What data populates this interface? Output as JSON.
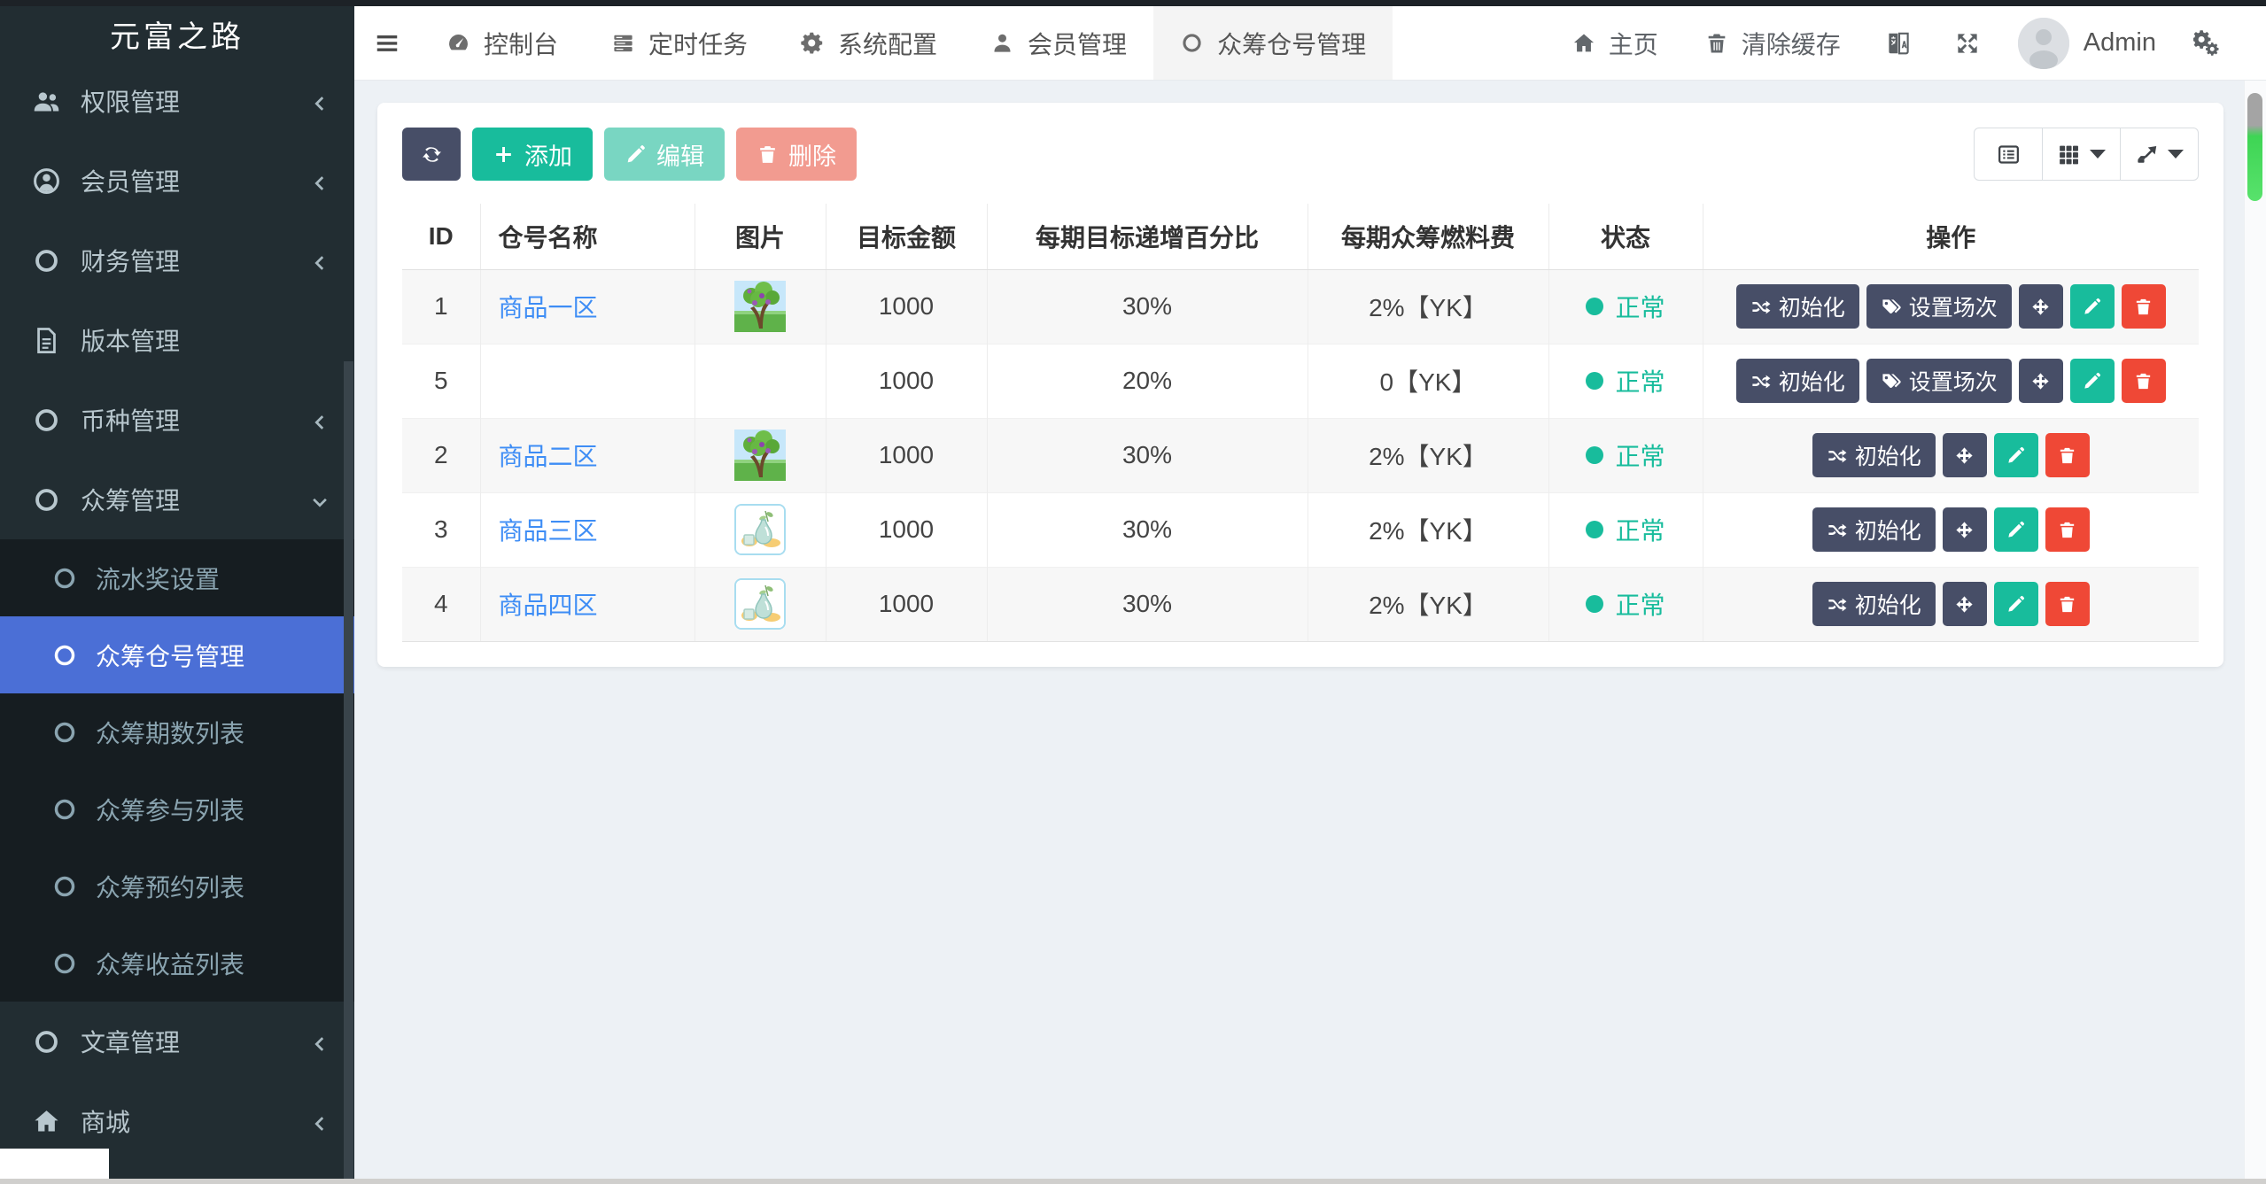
{
  "app_title": "元富之路",
  "colors": {
    "sidebar_bg": "#222d32",
    "submenu_bg": "#161d21",
    "active_menu": "#4b6fd6",
    "primary_green": "#18bc9c",
    "danger_red": "#ef4836",
    "dark_button": "#474e67",
    "link_blue": "#3e8df5",
    "status_green": "#18bc9c",
    "scrollbar_green": "#3ed554"
  },
  "sidebar": {
    "items": [
      {
        "icon": "users",
        "label": "权限管理",
        "chevron": "left"
      },
      {
        "icon": "user-circle",
        "label": "会员管理",
        "chevron": "left"
      },
      {
        "icon": "circle-o",
        "label": "财务管理",
        "chevron": "left"
      },
      {
        "icon": "file-text",
        "label": "版本管理"
      },
      {
        "icon": "circle-o",
        "label": "币种管理",
        "chevron": "left"
      },
      {
        "icon": "circle-o",
        "label": "众筹管理",
        "chevron": "down",
        "open": true,
        "children": [
          {
            "label": "流水奖设置"
          },
          {
            "label": "众筹仓号管理",
            "active": true
          },
          {
            "label": "众筹期数列表"
          },
          {
            "label": "众筹参与列表"
          },
          {
            "label": "众筹预约列表"
          },
          {
            "label": "众筹收益列表"
          }
        ]
      },
      {
        "icon": "circle-o",
        "label": "文章管理",
        "chevron": "left"
      },
      {
        "icon": "home",
        "label": "商城",
        "chevron": "left"
      }
    ]
  },
  "topbar": {
    "tabs": [
      {
        "icon": "tachometer",
        "label": "控制台"
      },
      {
        "icon": "tasks",
        "label": "定时任务"
      },
      {
        "icon": "gear",
        "label": "系统配置"
      },
      {
        "icon": "user",
        "label": "会员管理"
      },
      {
        "icon": "circle-o",
        "label": "众筹仓号管理",
        "active": true
      }
    ],
    "right": [
      {
        "type": "link",
        "icon": "home",
        "label": "主页"
      },
      {
        "type": "link",
        "icon": "trash",
        "label": "清除缓存"
      },
      {
        "type": "icon",
        "icon": "language"
      },
      {
        "type": "icon",
        "icon": "expand"
      },
      {
        "type": "user",
        "label": "Admin"
      },
      {
        "type": "icon",
        "icon": "cogs"
      }
    ]
  },
  "toolbar": {
    "buttons": [
      {
        "name": "refresh",
        "icon": "refresh",
        "label": "",
        "style": "dark refresh"
      },
      {
        "name": "add",
        "icon": "plus",
        "label": "添加",
        "style": "success"
      },
      {
        "name": "edit",
        "icon": "pencil",
        "label": "编辑",
        "style": "success disabled"
      },
      {
        "name": "delete",
        "icon": "trash",
        "label": "删除",
        "style": "danger disabled"
      }
    ],
    "view_buttons": [
      {
        "name": "detail-view",
        "icon": "list-alt",
        "caret": false
      },
      {
        "name": "columns-view",
        "icon": "th",
        "caret": true
      },
      {
        "name": "export",
        "icon": "export",
        "caret": true
      }
    ]
  },
  "table": {
    "columns": [
      "ID",
      "仓号名称",
      "图片",
      "目标金额",
      "每期目标递增百分比",
      "每期众筹燃料费",
      "状态",
      "操作"
    ],
    "action_labels": {
      "init": "初始化",
      "session": "设置场次"
    },
    "rows": [
      {
        "id": "1",
        "name": "商品一区",
        "image": "tree",
        "target": "1000",
        "increase": "30%",
        "fuel": "2%【YK】",
        "status": "正常",
        "actions": [
          "init",
          "session",
          "move",
          "edit",
          "delete"
        ]
      },
      {
        "id": "5",
        "name": "",
        "image": "none",
        "target": "1000",
        "increase": "20%",
        "fuel": "0【YK】",
        "status": "正常",
        "actions": [
          "init",
          "session",
          "move",
          "edit",
          "delete"
        ]
      },
      {
        "id": "2",
        "name": "商品二区",
        "image": "tree",
        "target": "1000",
        "increase": "30%",
        "fuel": "2%【YK】",
        "status": "正常",
        "actions": [
          "init",
          "move",
          "edit",
          "delete"
        ]
      },
      {
        "id": "3",
        "name": "商品三区",
        "image": "vase",
        "target": "1000",
        "increase": "30%",
        "fuel": "2%【YK】",
        "status": "正常",
        "actions": [
          "init",
          "move",
          "edit",
          "delete"
        ]
      },
      {
        "id": "4",
        "name": "商品四区",
        "image": "vase",
        "target": "1000",
        "increase": "30%",
        "fuel": "2%【YK】",
        "status": "正常",
        "actions": [
          "init",
          "move",
          "edit",
          "delete"
        ]
      }
    ]
  }
}
